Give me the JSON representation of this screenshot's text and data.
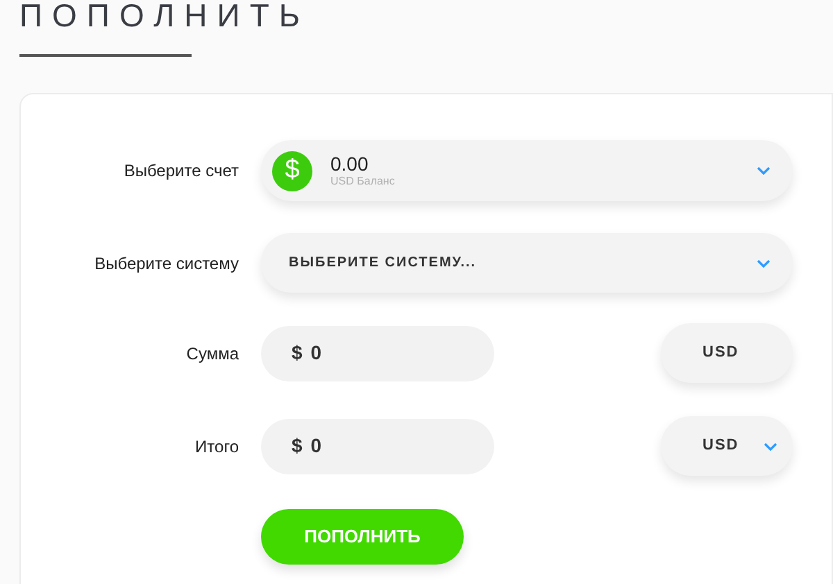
{
  "title": "ПОПОЛНИТЬ",
  "form": {
    "rows": [
      {
        "kind": "account",
        "label": "Выберите счет",
        "amount": "0.00",
        "caption": "USD Баланс",
        "icon_text": "$"
      },
      {
        "kind": "select",
        "label": "Выберите систему",
        "placeholder": "ВЫБЕРИТЕ СИСТЕМУ..."
      },
      {
        "kind": "money",
        "label": "Сумма",
        "currency_sign": "$",
        "value": "0",
        "currency": "USD",
        "dropdown": false
      },
      {
        "kind": "money",
        "label": "Итого",
        "currency_sign": "$",
        "value": "0",
        "currency": "USD",
        "dropdown": true
      }
    ],
    "submit": "ПОПОЛНИТЬ"
  }
}
